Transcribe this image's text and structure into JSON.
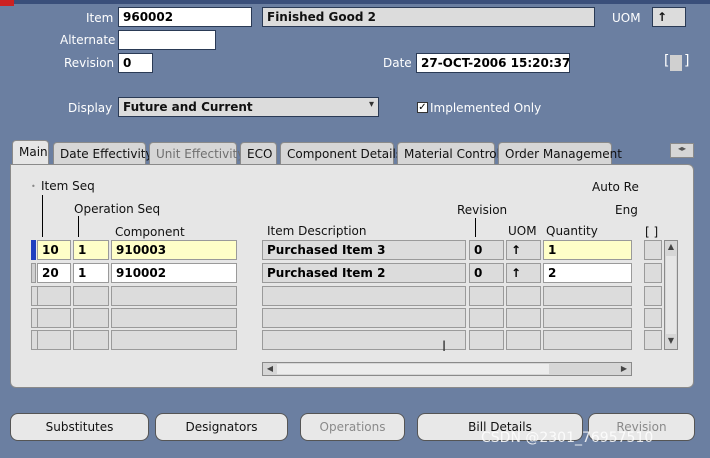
{
  "header": {
    "item_label": "Item",
    "item_value": "960002",
    "item_desc": "Finished Good 2",
    "uom_label": "UOM",
    "uom_value": "↑",
    "alternate_label": "Alternate",
    "alternate_value": "",
    "revision_label": "Revision",
    "revision_value": "0",
    "date_label": "Date",
    "date_value": "27-OCT-2006 15:20:37",
    "display_label": "Display",
    "display_value": "Future and Current",
    "implemented_only_label": "Implemented Only",
    "implemented_only_checked": true
  },
  "tabs": [
    {
      "label": "Main",
      "active": true,
      "disabled": false
    },
    {
      "label": "Date Effectivity",
      "active": false,
      "disabled": false
    },
    {
      "label": "Unit Effectivity",
      "active": false,
      "disabled": true
    },
    {
      "label": "ECO",
      "active": false,
      "disabled": false
    },
    {
      "label": "Component Details",
      "active": false,
      "disabled": false
    },
    {
      "label": "Material Control",
      "active": false,
      "disabled": false
    },
    {
      "label": "Order Management",
      "active": false,
      "disabled": false
    }
  ],
  "grid": {
    "col_item_seq": "Item Seq",
    "col_operation_seq": "Operation Seq",
    "col_component": "Component",
    "col_item_description": "Item Description",
    "col_revision": "Revision",
    "col_uom": "UOM",
    "col_quantity": "Quantity",
    "col_auto_request": "Auto Re",
    "col_eng": "Eng",
    "col_bracket": "[ ]",
    "rows": [
      {
        "item_seq": "10",
        "op_seq": "1",
        "component": "910003",
        "description": "Purchased Item 3",
        "revision": "0",
        "uom": "↑",
        "quantity": "1"
      },
      {
        "item_seq": "20",
        "op_seq": "1",
        "component": "910002",
        "description": "Purchased Item 2",
        "revision": "0",
        "uom": "↑",
        "quantity": "2"
      }
    ]
  },
  "buttons": {
    "substitutes": "Substitutes",
    "designators": "Designators",
    "operations": "Operations",
    "bill_details": "Bill Details",
    "revision": "Revision"
  },
  "watermark": "CSDN @2301_76957510"
}
